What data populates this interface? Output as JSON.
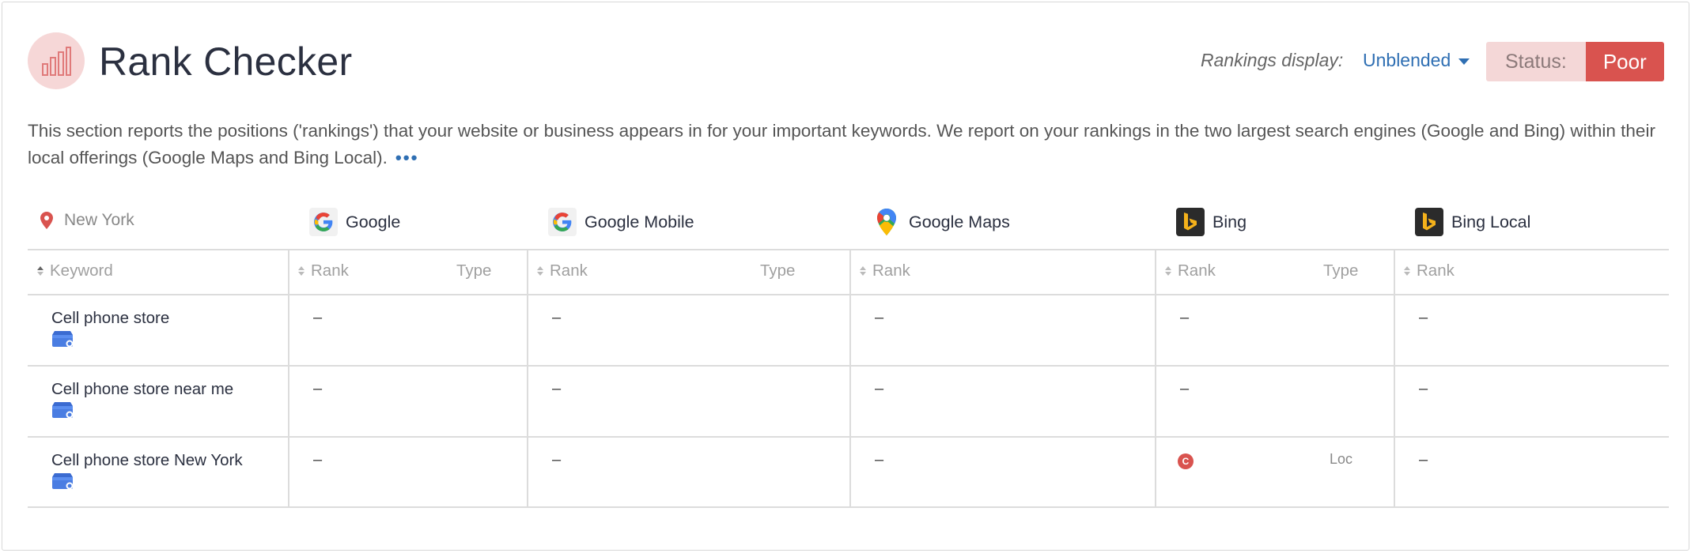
{
  "header": {
    "title": "Rank Checker",
    "rankings_display_label": "Rankings display:",
    "rankings_display_value": "Unblended",
    "status_label": "Status:",
    "status_value": "Poor",
    "status_color": "#d9534f"
  },
  "description": {
    "text": "This section reports the positions ('rankings') that your website or business appears in for your important keywords. We report on your rankings in the two largest search engines (Google and Bing) within their local offerings (Google Maps and Bing Local).",
    "more": "•••"
  },
  "location": {
    "name": "New York",
    "icon": "map-pin-icon"
  },
  "engines": [
    {
      "name": "Google",
      "icon": "google-icon"
    },
    {
      "name": "Google Mobile",
      "icon": "google-icon"
    },
    {
      "name": "Google Maps",
      "icon": "google-maps-icon"
    },
    {
      "name": "Bing",
      "icon": "bing-icon"
    },
    {
      "name": "Bing Local",
      "icon": "bing-icon"
    }
  ],
  "columns": {
    "keyword": "Keyword",
    "rank": "Rank",
    "type": "Type"
  },
  "rows": [
    {
      "keyword": "Cell phone store",
      "google_rank": "–",
      "google_mobile_rank": "–",
      "google_maps_rank": "–",
      "bing_rank": "–",
      "bing_local_rank": "–"
    },
    {
      "keyword": "Cell phone store near me",
      "google_rank": "–",
      "google_mobile_rank": "–",
      "google_maps_rank": "–",
      "bing_rank": "–",
      "bing_local_rank": "–"
    },
    {
      "keyword": "Cell phone store New York",
      "google_rank": "–",
      "google_mobile_rank": "–",
      "google_maps_rank": "–",
      "bing_rank_badge": "C",
      "bing_type": "Loc",
      "bing_local_rank": "–"
    }
  ]
}
